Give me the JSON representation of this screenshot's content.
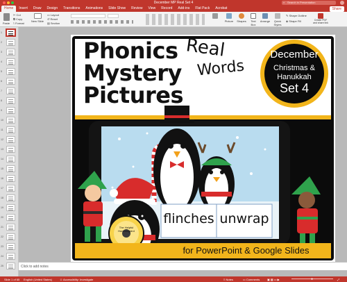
{
  "window": {
    "title": "December MP Real Set 4"
  },
  "search": {
    "placeholder": "Search in Presentation"
  },
  "tabs": [
    "Home",
    "Insert",
    "Draw",
    "Design",
    "Transitions",
    "Animations",
    "Slide Show",
    "Review",
    "View",
    "Record",
    "Add-ins",
    "Flat Pack",
    "Acrobat"
  ],
  "share_label": "Share",
  "ribbon": {
    "paste": "Paste",
    "cut": "Cut",
    "copy": "Copy",
    "format": "Format",
    "new_slide": "New Slide",
    "layout": "Layout",
    "reset": "Reset",
    "section": "Section",
    "picture": "Picture",
    "shapes": "Shapes",
    "text_box": "Text Box",
    "arrange": "Arrange",
    "quick_styles": "Quick Styles",
    "shape_outline": "Shape Outline",
    "shape_fill": "Shape Fill",
    "create_pdf": "Create PDF and share link"
  },
  "slide_numbers": [
    "1",
    "2",
    "3",
    "4",
    "5",
    "6",
    "7",
    "8",
    "9",
    "10",
    "11",
    "12",
    "13",
    "14",
    "15",
    "16",
    "17",
    "18",
    "19",
    "20",
    "21",
    "22",
    "23",
    "24",
    "25"
  ],
  "slide": {
    "line1": "Phonics",
    "line2": "Mystery",
    "line3": "Pictures",
    "real": "Real",
    "words": "Words",
    "month": "December",
    "theme1": "Christmas &",
    "theme2": "Hanukkah",
    "set": "Set 4",
    "word1": "flinches",
    "word2": "unwrap",
    "logo_text": "The Helpful Hummingbird",
    "footer": "for PowerPoint & Google Slides"
  },
  "notes": {
    "placeholder": "Click to add notes"
  },
  "status": {
    "slide_count": "Slide 1 of 65",
    "language": "English (United States)",
    "accessibility": "Accessibility: Investigate",
    "notes_btn": "Notes",
    "comments_btn": "Comments"
  },
  "colors": {
    "accent": "#c0362c",
    "gold": "#f2b51b",
    "black": "#0b0b0b"
  }
}
